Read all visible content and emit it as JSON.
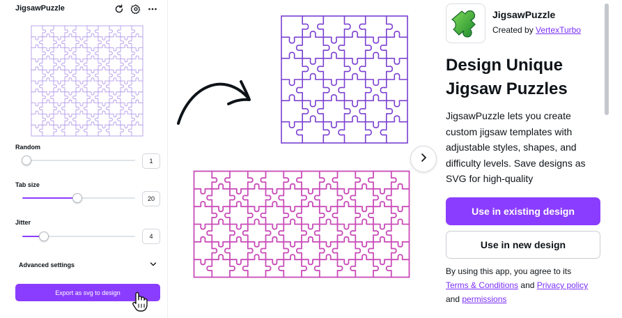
{
  "panel": {
    "title": "JigsawPuzzle",
    "icons": [
      "refresh-icon",
      "gear-icon",
      "more-icon"
    ],
    "sliders": [
      {
        "label": "Random",
        "value": "1",
        "fraction": 0.04
      },
      {
        "label": "Tab size",
        "value": "20",
        "fraction": 0.49
      },
      {
        "label": "Jitter",
        "value": "4",
        "fraction": 0.19
      }
    ],
    "advanced_label": "Advanced settings",
    "export_label": "Export as svg to design"
  },
  "colors": {
    "accent": "#8b3dff",
    "preview_line": "#a98ee8",
    "square_puzzle": "#7a3fd0",
    "rect_puzzle": "#c94cb8",
    "link": "#7b2ff7"
  },
  "app": {
    "name": "JigsawPuzzle",
    "created_by": "Created by",
    "creator": "VertexTurbo",
    "headline_line1": "Design Unique",
    "headline_line2": "Jigsaw Puzzles",
    "description": "JigsawPuzzle lets you create custom jigsaw templates with adjustable styles, shapes, and difficulty levels. Save designs as SVG for high-quality",
    "use_existing": "Use in existing design",
    "use_new": "Use in new design",
    "terms_prefix": "By using this app, you agree to its",
    "terms_link": "Terms & Conditions",
    "and1": "and",
    "privacy_link": "Privacy policy",
    "and2": "and",
    "permissions_link": "permissions"
  }
}
